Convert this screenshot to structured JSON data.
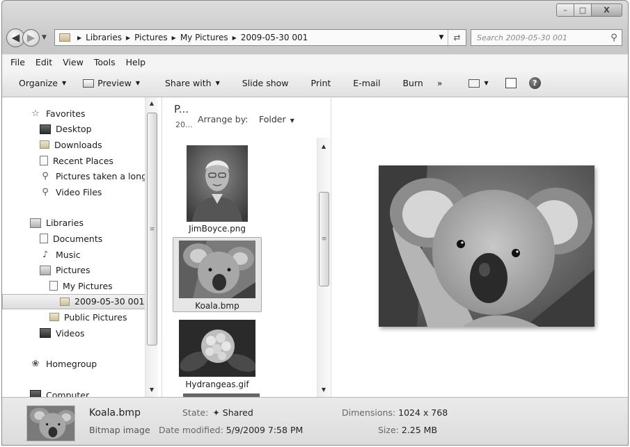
{
  "window": {
    "controls": {
      "minimize": "–",
      "maximize": "□",
      "close": "X"
    }
  },
  "nav": {
    "breadcrumb": [
      "Libraries",
      "Pictures",
      "My Pictures",
      "2009-05-30 001"
    ],
    "search_placeholder": "Search 2009-05-30 001"
  },
  "menu": [
    "File",
    "Edit",
    "View",
    "Tools",
    "Help"
  ],
  "toolbar": {
    "organize": "Organize",
    "preview": "Preview",
    "share_with": "Share with",
    "slide_show": "Slide show",
    "print": "Print",
    "email": "E-mail",
    "burn": "Burn",
    "more": "»"
  },
  "sidebar": {
    "favorites": {
      "label": "Favorites",
      "items": [
        "Desktop",
        "Downloads",
        "Recent Places",
        "Pictures taken a long",
        "Video Files"
      ]
    },
    "libraries": {
      "label": "Libraries",
      "items": [
        "Documents",
        "Music",
        "Pictures",
        "My Pictures",
        "2009-05-30 001",
        "Public Pictures",
        "Videos"
      ]
    },
    "homegroup": "Homegroup",
    "computer": "Computer"
  },
  "library_pane": {
    "title": "P...",
    "subtitle": "20...",
    "arrange_label": "Arrange by:",
    "arrange_value": "Folder"
  },
  "files": [
    {
      "name": "JimBoyce.png"
    },
    {
      "name": "Koala.bmp"
    },
    {
      "name": "Hydrangeas.gif"
    }
  ],
  "details": {
    "name": "Koala.bmp",
    "type": "Bitmap image",
    "state_label": "State:",
    "state_value": "Shared",
    "date_label": "Date modified:",
    "date_value": "5/9/2009 7:58 PM",
    "dims_label": "Dimensions:",
    "dims_value": "1024 x 768",
    "size_label": "Size:",
    "size_value": "2.25 MB"
  }
}
